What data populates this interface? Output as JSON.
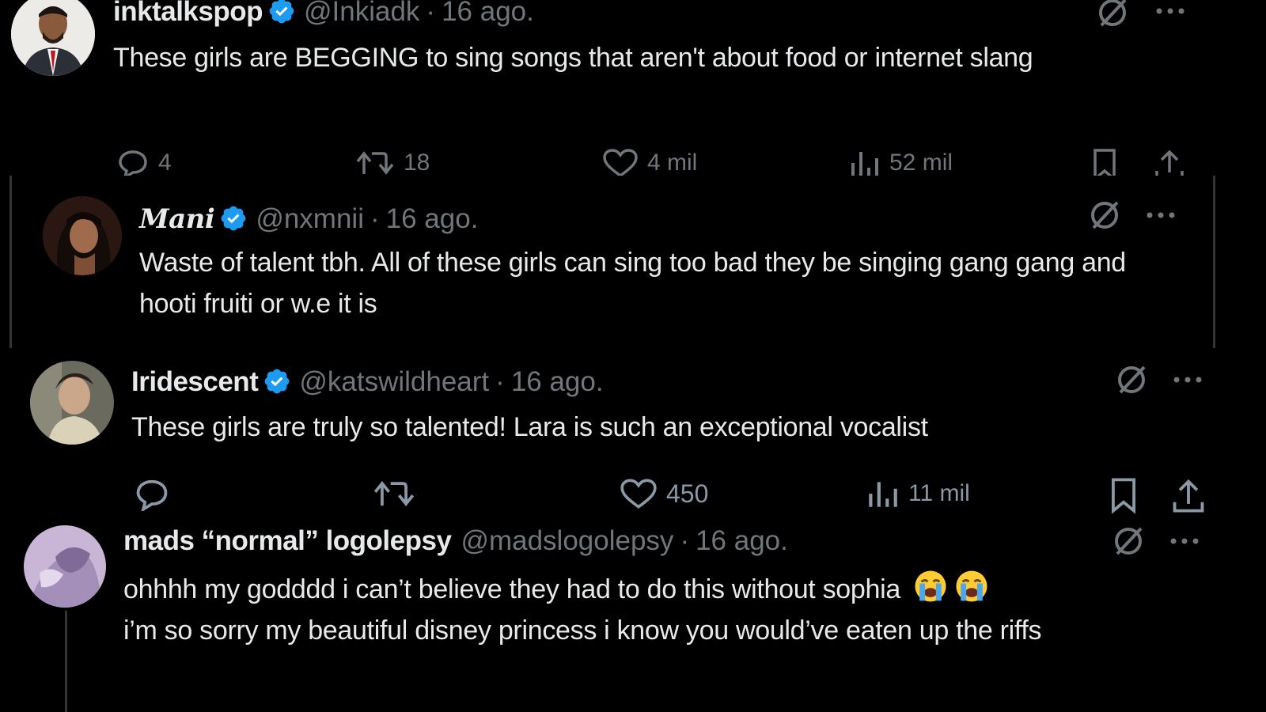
{
  "tweets": [
    {
      "name": "inktalkspop",
      "handle": "@Inkiadk",
      "dot": "·",
      "time": "16 ago.",
      "text": "These girls are BEGGING to sing songs that aren't about food or internet slang",
      "actions": {
        "replies": "4",
        "reposts": "18",
        "likes": "4 mil",
        "views": "52 mil"
      }
    },
    {
      "name": "Mani",
      "handle": "@nxmnii",
      "dot": "·",
      "time": "16 ago.",
      "text": "Waste of talent tbh. All of these girls can sing too bad they be singing gang gang and hooti fruiti or w.e it is"
    },
    {
      "name": "Iridescent",
      "handle": "@katswildheart",
      "dot": "·",
      "time": "16 ago.",
      "text": "These girls are truly so talented! Lara is such an exceptional vocalist",
      "actions": {
        "replies": "",
        "reposts": "",
        "likes": "450",
        "views": "11 mil"
      }
    },
    {
      "name": "mads “normal” logolepsy",
      "handle": "@madslogolepsy",
      "dot": "·",
      "time": "16 ago.",
      "text_line1": "ohhhh my godddd i can’t believe they had to do this without sophia",
      "text_rest": "i’m so sorry my beautiful disney princess i know you would’ve eaten up the riffs"
    }
  ],
  "colors": {
    "background": "#000000",
    "text": "#e7e9ea",
    "muted": "#71767b",
    "verified": "#1d9bf0"
  },
  "icons": [
    "grok-slash-icon",
    "more-icon",
    "reply-icon",
    "repost-icon",
    "like-icon",
    "views-icon",
    "bookmark-icon",
    "share-icon",
    "verified-badge-icon",
    "crying-emoji-icon"
  ]
}
